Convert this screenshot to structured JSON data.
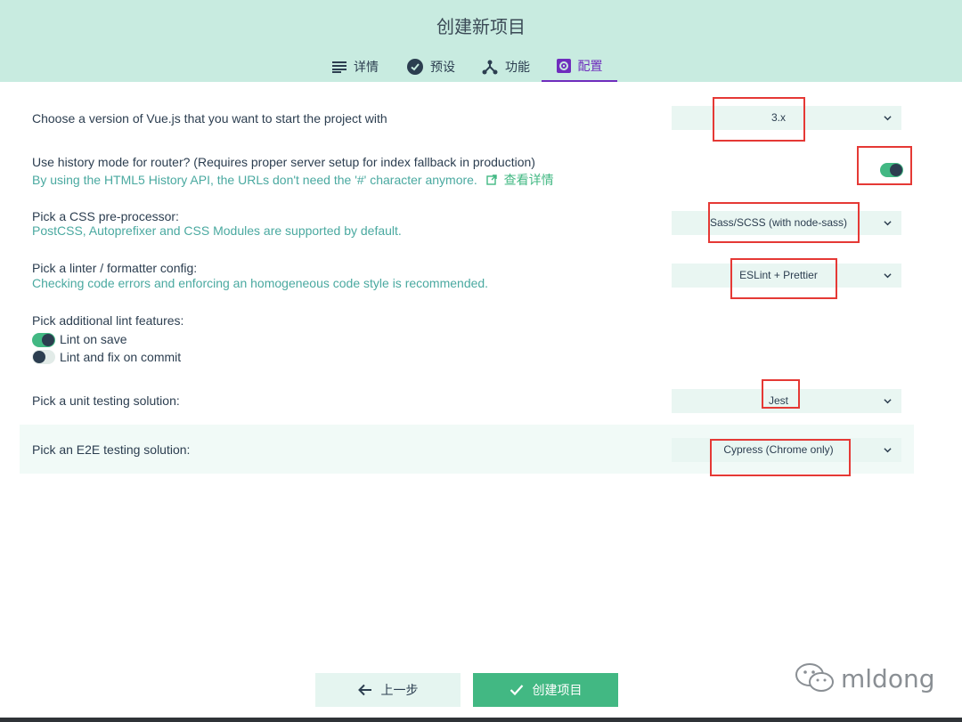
{
  "header": {
    "title": "创建新项目",
    "tabs": [
      {
        "label": "详情",
        "icon": "list-icon"
      },
      {
        "label": "预设",
        "icon": "check-circle-icon"
      },
      {
        "label": "功能",
        "icon": "fork-icon"
      },
      {
        "label": "配置",
        "icon": "settings-icon"
      }
    ],
    "active_tab": "配置"
  },
  "config": {
    "vue_version": {
      "label": "Choose a version of Vue.js that you want to start the project with",
      "value": "3.x"
    },
    "history_mode": {
      "label": "Use history mode for router? (Requires proper server setup for index fallback in production)",
      "description": "By using the HTML5 History API, the URLs don't need the '#' character anymore.",
      "link": "查看详情",
      "enabled": true
    },
    "css_preprocessor": {
      "label": "Pick a CSS pre-processor:",
      "description": "PostCSS, Autoprefixer and CSS Modules are supported by default.",
      "value": "Sass/SCSS (with node-sass)"
    },
    "linter": {
      "label": "Pick a linter / formatter config:",
      "description": "Checking code errors and enforcing an homogeneous code style is recommended.",
      "value": "ESLint + Prettier"
    },
    "lint_features": {
      "label": "Pick additional lint features:",
      "options": [
        {
          "label": "Lint on save",
          "enabled": true
        },
        {
          "label": "Lint and fix on commit",
          "enabled": false
        }
      ]
    },
    "unit_testing": {
      "label": "Pick a unit testing solution:",
      "value": "Jest"
    },
    "e2e_testing": {
      "label": "Pick an E2E testing solution:",
      "value": "Cypress (Chrome only)"
    }
  },
  "footer": {
    "prev_label": "上一步",
    "create_label": "创建项目"
  },
  "watermark": {
    "text": "mldong"
  },
  "colors": {
    "header_bg": "#c8ebe0",
    "accent": "#42b883",
    "active_tab": "#6f2dbd",
    "highlight": "#e53935",
    "link": "#4aa9a0"
  }
}
